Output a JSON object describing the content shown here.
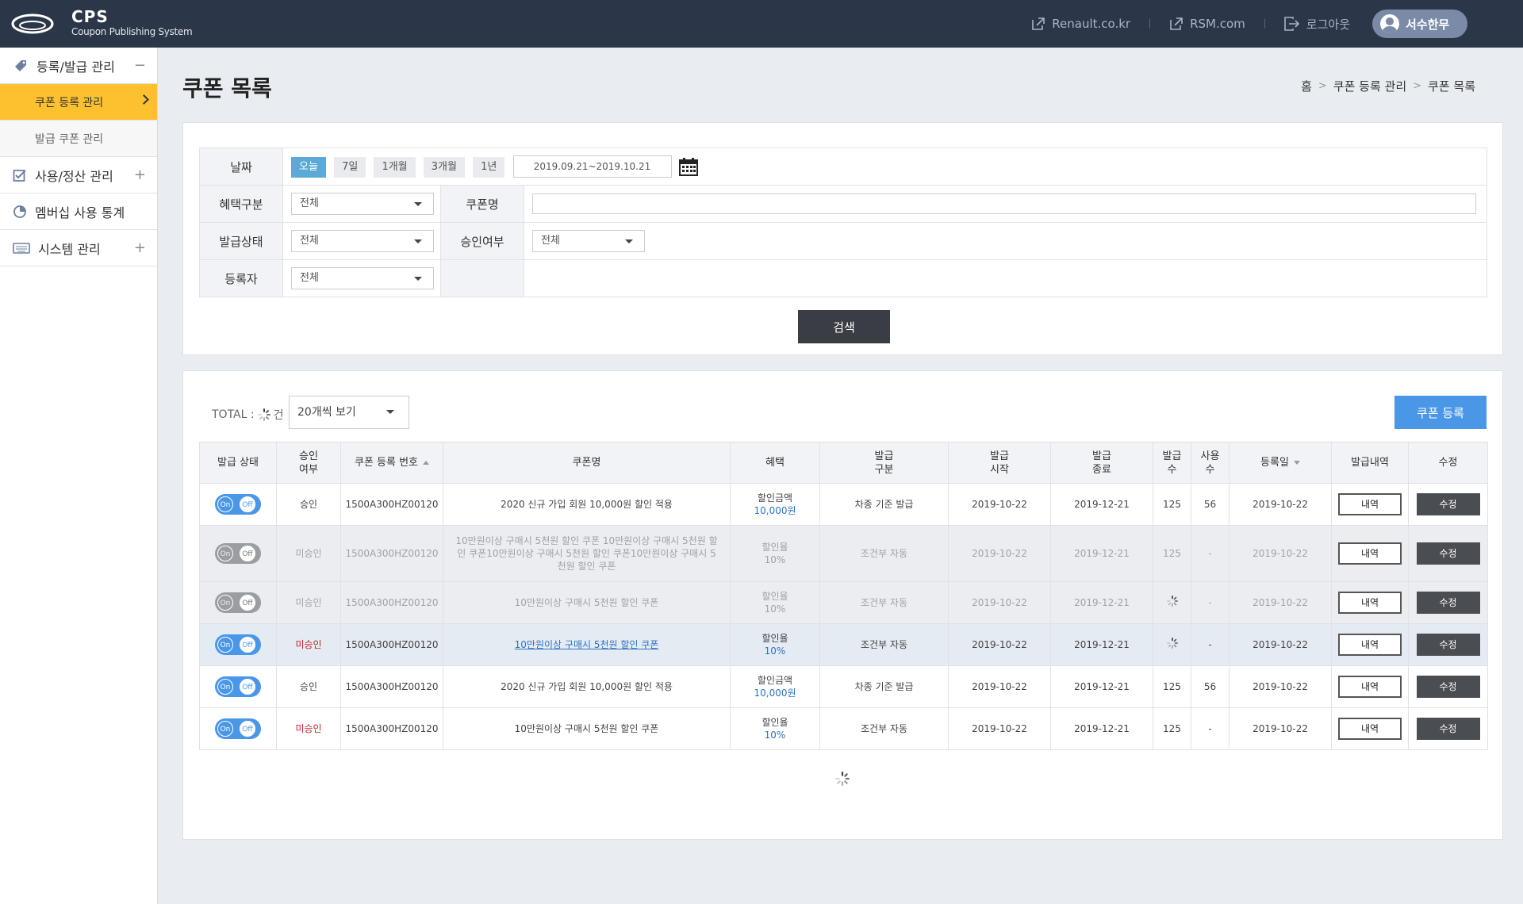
{
  "app": {
    "title": "CPS",
    "subtitle": "Coupon Publishing System"
  },
  "header": {
    "links": [
      {
        "label": "Renault.co.kr",
        "icon": "external-link-icon"
      },
      {
        "label": "RSM.com",
        "icon": "external-link-icon"
      },
      {
        "label": "로그아웃",
        "icon": "logout-icon"
      }
    ],
    "user": "서수한무"
  },
  "sidebar": {
    "groups": [
      {
        "label": "등록/발급 관리",
        "icon": "tag-icon",
        "toggle": "−"
      },
      {
        "label": "사용/정산 관리",
        "icon": "checkbox-icon",
        "toggle": "+"
      },
      {
        "label": "멤버십 사용 통계",
        "icon": "pie-chart-icon"
      },
      {
        "label": "시스템 관리",
        "icon": "keyboard-icon",
        "toggle": "+"
      }
    ],
    "subitems": [
      {
        "label": "쿠폰 등록 관리",
        "active": true
      },
      {
        "label": "발급 쿠폰 관리",
        "active": false
      }
    ],
    "accent_color": "#fdc02f"
  },
  "page": {
    "title": "쿠폰 목록",
    "breadcrumb": [
      "홈",
      "쿠폰 등록 관리",
      "쿠폰 목록"
    ]
  },
  "filters": {
    "date_label": "날짜",
    "date_buttons": [
      "오늘",
      "7일",
      "1개월",
      "3개월",
      "1년"
    ],
    "date_range": "2019.09.21~2019.10.21",
    "benefit_label": "혜택구분",
    "benefit_value": "전체",
    "coupon_name_label": "쿠폰명",
    "coupon_name_value": "",
    "issue_status_label": "발급상태",
    "issue_status_value": "전체",
    "approval_label": "승인여부",
    "approval_value": "전체",
    "registrant_label": "등록자",
    "registrant_value": "전체",
    "search_button": "검색"
  },
  "list": {
    "total_prefix": "TOTAL :",
    "total_suffix": "건",
    "page_size": "20개씩 보기",
    "register_button": "쿠폰 등록",
    "columns": [
      "발급 상태",
      "승인 여부",
      "쿠폰 등록 번호",
      "쿠폰명",
      "혜택",
      "발급 구분",
      "발급 시작",
      "발급 종료",
      "발급 수",
      "사용 수",
      "등록일",
      "발급내역",
      "수정"
    ],
    "column_lines": [
      [
        "발급 상태"
      ],
      [
        "승인",
        "여부"
      ],
      [
        "쿠폰 등록 번호"
      ],
      [
        "쿠폰명"
      ],
      [
        "혜택"
      ],
      [
        "발급",
        "구분"
      ],
      [
        "발급",
        "시작"
      ],
      [
        "발급",
        "종료"
      ],
      [
        "발급",
        "수"
      ],
      [
        "사용",
        "수"
      ],
      [
        "등록일"
      ],
      [
        "발급내역"
      ],
      [
        "수정"
      ]
    ],
    "toggle_on": "On",
    "toggle_off": "Off",
    "detail_button": "내역",
    "edit_button": "수정",
    "rows": [
      {
        "approval": "승인",
        "approval_color": "normal",
        "code": "1500A300HZ00120",
        "name": "2020 신규 가입 회원 10,000원 할인 적용",
        "benefit_type": "할인금액",
        "benefit_value": "10,000원",
        "issue_type": "차종 기준 발급",
        "start": "2019-10-22",
        "end": "2019-12-21",
        "issued": "125",
        "used": "56",
        "reg_date": "2019-10-22",
        "state": "normal"
      },
      {
        "approval": "미승인",
        "approval_color": "dim",
        "code": "1500A300HZ00120",
        "name": "10만원이상 구매시 5천원 할인 쿠폰 10만원이상 구매시 5천원 할인 쿠폰10만원이상 구매시 5천원 할인 쿠폰10만원이상 구매시 5천원 할인 쿠폰",
        "benefit_type": "할인율",
        "benefit_value": "10%",
        "issue_type": "조건부 자동",
        "start": "2019-10-22",
        "end": "2019-12-21",
        "issued": "125",
        "used": "-",
        "reg_date": "2019-10-22",
        "state": "dim"
      },
      {
        "approval": "미승인",
        "approval_color": "dim",
        "code": "1500A300HZ00120",
        "name": "10만원이상 구매시 5천원 할인 쿠폰",
        "benefit_type": "할인율",
        "benefit_value": "10%",
        "issue_type": "조건부 자동",
        "start": "2019-10-22",
        "end": "2019-12-21",
        "issued": "",
        "used": "-",
        "reg_date": "2019-10-22",
        "state": "dim"
      },
      {
        "approval": "미승인",
        "approval_color": "red",
        "code": "1500A300HZ00120",
        "name": "10만원이상 구매시 5천원 할인 쿠폰",
        "benefit_type": "할인율",
        "benefit_value": "10%",
        "issue_type": "조건부 자동",
        "start": "2019-10-22",
        "end": "2019-12-21",
        "issued": "",
        "used": "-",
        "reg_date": "2019-10-22",
        "state": "highlight"
      },
      {
        "approval": "승인",
        "approval_color": "normal",
        "code": "1500A300HZ00120",
        "name": "2020 신규 가입 회원 10,000원 할인 적용",
        "benefit_type": "할인금액",
        "benefit_value": "10,000원",
        "issue_type": "차종 기준 발급",
        "start": "2019-10-22",
        "end": "2019-12-21",
        "issued": "125",
        "used": "56",
        "reg_date": "2019-10-22",
        "state": "normal"
      },
      {
        "approval": "미승인",
        "approval_color": "red",
        "code": "1500A300HZ00120",
        "name": "10만원이상 구매시 5천원 할인 쿠폰",
        "benefit_type": "할인율",
        "benefit_value": "10%",
        "issue_type": "조건부 자동",
        "start": "2019-10-22",
        "end": "2019-12-21",
        "issued": "125",
        "used": "-",
        "reg_date": "2019-10-22",
        "state": "normal"
      }
    ]
  },
  "colors": {
    "topbar": "#2b3648",
    "primary_blue": "#4a97e8",
    "approval_red": "#c7222a",
    "link_blue": "#2e72c4"
  }
}
